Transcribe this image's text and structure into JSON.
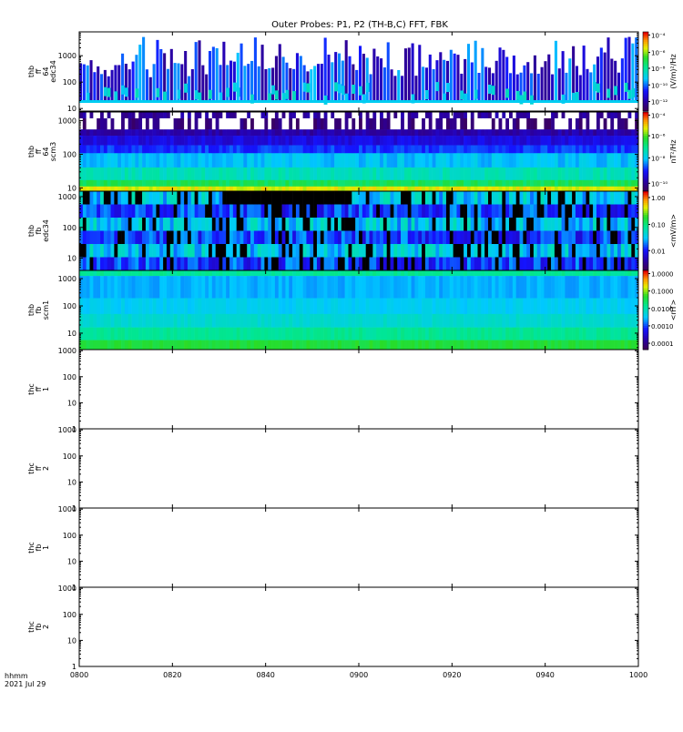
{
  "chart_data": {
    "type": "heatmap",
    "title": "Outer Probes: P1, P2 (TH-B,C) FFT, FBK",
    "time_axis": {
      "label_line1": "hhmm",
      "label_line2": "2021 Jul 29",
      "ticks": [
        "0800",
        "0820",
        "0840",
        "0900",
        "0920",
        "0940",
        "1000"
      ],
      "range": [
        "08:00",
        "10:00"
      ]
    },
    "panels": [
      {
        "name": "thb-ff-64-edc34",
        "ylabel": [
          "thb",
          "ff",
          "64",
          "edc34"
        ],
        "yscale": "log",
        "ylim": [
          8,
          8000
        ],
        "yticks": [
          [
            "10",
            10
          ],
          [
            "100",
            100
          ],
          [
            "1000",
            1000
          ]
        ],
        "pattern": "sparse-e",
        "colorbar": {
          "palette": "rainbow",
          "label": "(V/m)²/Hz",
          "ticks": [
            [
              "10⁻⁴",
              0.04
            ],
            [
              "10⁻⁶",
              0.26
            ],
            [
              "10⁻⁸",
              0.46
            ],
            [
              "10⁻¹⁰",
              0.67
            ],
            [
              "10⁻¹²",
              0.88
            ]
          ]
        }
      },
      {
        "name": "thb-ff-64-scm3",
        "ylabel": [
          "thb",
          "ff",
          "64",
          "scm3"
        ],
        "yscale": "log",
        "ylim": [
          8,
          1800
        ],
        "yticks": [
          [
            "10",
            10
          ],
          [
            "100",
            100
          ],
          [
            "1000",
            1000
          ]
        ],
        "pattern": "scm-ff",
        "colorbar": {
          "palette": "rainbow",
          "label": "nT²/Hz",
          "ticks": [
            [
              "10⁻⁴",
              0.04
            ],
            [
              "10⁻⁶",
              0.3
            ],
            [
              "10⁻⁸",
              0.58
            ],
            [
              "10⁻¹⁰",
              0.9
            ]
          ]
        }
      },
      {
        "name": "thb-fb-edc34",
        "ylabel": [
          "thb",
          "fb",
          "edc34"
        ],
        "yscale": "log",
        "ylim": [
          4,
          1500
        ],
        "yticks": [
          [
            "10",
            10
          ],
          [
            "100",
            100
          ],
          [
            "1000",
            1000
          ]
        ],
        "pattern": "fbk-e",
        "colorbar": {
          "palette": "rainbow",
          "label": "<mV/m>",
          "ticks": [
            [
              "1.00",
              0.08
            ],
            [
              "0.10",
              0.42
            ],
            [
              "0.01",
              0.75
            ]
          ]
        }
      },
      {
        "name": "thb-fb-scm1",
        "ylabel": [
          "thb",
          "fb",
          "scm1"
        ],
        "yscale": "log",
        "ylim": [
          2.5,
          2000
        ],
        "yticks": [
          [
            "10",
            10
          ],
          [
            "100",
            100
          ],
          [
            "1000",
            1000
          ]
        ],
        "pattern": "fbk-scm",
        "colorbar": {
          "palette": "rainbow",
          "label": "<nT>",
          "ticks": [
            [
              "1.0000",
              0.04
            ],
            [
              "0.1000",
              0.26
            ],
            [
              "0.0100",
              0.48
            ],
            [
              "0.0010",
              0.7
            ],
            [
              "0.0001",
              0.92
            ]
          ]
        }
      },
      {
        "name": "thc-ff-1",
        "ylabel": [
          "thc",
          "ff",
          "1"
        ],
        "yscale": "log",
        "ylim": [
          1,
          1100
        ],
        "yticks": [
          [
            "1",
            1
          ],
          [
            "10",
            10
          ],
          [
            "100",
            100
          ],
          [
            "1000",
            1000
          ]
        ],
        "pattern": "empty"
      },
      {
        "name": "thc-ff-2",
        "ylabel": [
          "thc",
          "ff",
          "2"
        ],
        "yscale": "log",
        "ylim": [
          1,
          1100
        ],
        "yticks": [
          [
            "1",
            1
          ],
          [
            "10",
            10
          ],
          [
            "100",
            100
          ],
          [
            "1000",
            1000
          ]
        ],
        "pattern": "empty"
      },
      {
        "name": "thc-fb-1",
        "ylabel": [
          "thc",
          "fb",
          "1"
        ],
        "yscale": "log",
        "ylim": [
          1,
          1100
        ],
        "yticks": [
          [
            "1",
            1
          ],
          [
            "10",
            10
          ],
          [
            "100",
            100
          ],
          [
            "1000",
            1000
          ]
        ],
        "pattern": "empty"
      },
      {
        "name": "thc-fb-2",
        "ylabel": [
          "thc",
          "fb",
          "2"
        ],
        "yscale": "log",
        "ylim": [
          1,
          1100
        ],
        "yticks": [
          [
            "1",
            1
          ],
          [
            "10",
            10
          ],
          [
            "100",
            100
          ],
          [
            "1000",
            1000
          ]
        ],
        "pattern": "empty"
      }
    ]
  }
}
